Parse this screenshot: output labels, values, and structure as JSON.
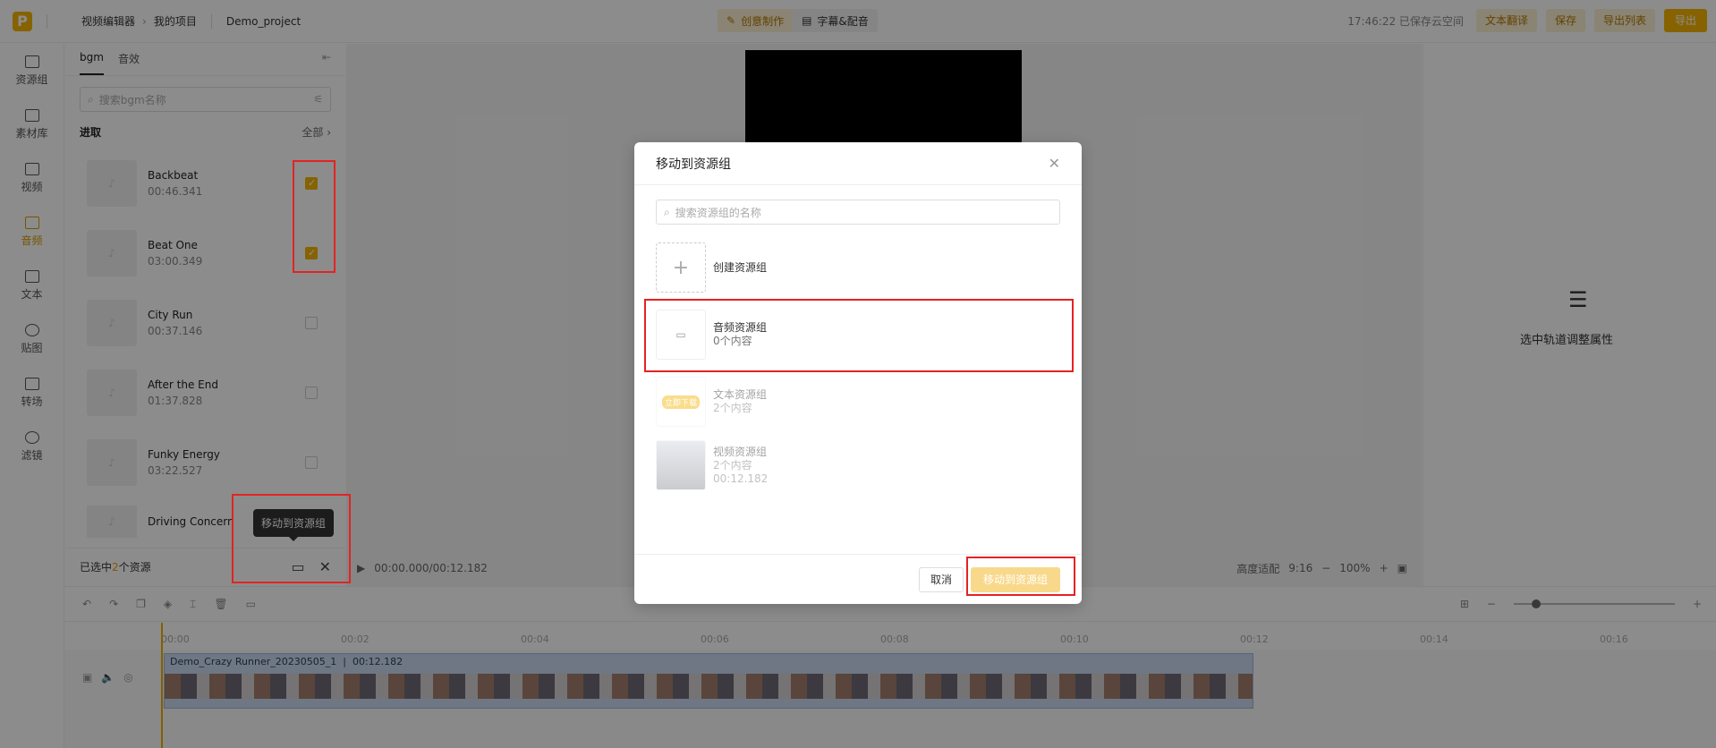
{
  "app": {
    "logo": "P",
    "breadcrumb": [
      "视频编辑器",
      "我的项目",
      "Demo_project"
    ]
  },
  "center_tabs": [
    {
      "label": "创意制作"
    },
    {
      "label": "字幕&配音"
    }
  ],
  "header_right": {
    "save_status": "17:46:22 已保存云空间",
    "translate": "文本翻译",
    "save": "保存",
    "export_list": "导出列表",
    "export": "导出"
  },
  "nav": [
    {
      "label": "资源组"
    },
    {
      "label": "素材库"
    },
    {
      "label": "视频"
    },
    {
      "label": "音频"
    },
    {
      "label": "文本"
    },
    {
      "label": "贴图"
    },
    {
      "label": "转场"
    },
    {
      "label": "滤镜"
    }
  ],
  "panel": {
    "tabs": [
      "bgm",
      "音效"
    ],
    "search_placeholder": "搜索bgm名称",
    "section_title": "进取",
    "section_all": "全部",
    "tracks": [
      {
        "name": "Backbeat",
        "duration": "00:46.341",
        "checked": true
      },
      {
        "name": "Beat One",
        "duration": "03:00.349",
        "checked": true
      },
      {
        "name": "City Run",
        "duration": "00:37.146",
        "checked": false
      },
      {
        "name": "After the End",
        "duration": "01:37.828",
        "checked": false
      },
      {
        "name": "Funky Energy",
        "duration": "03:22.527",
        "checked": false
      },
      {
        "name": "Driving Concern",
        "duration": "",
        "checked": false
      }
    ],
    "selection_prefix": "已选中",
    "selection_count": "2",
    "selection_suffix": "个资源",
    "tooltip": "移动到资源组"
  },
  "props": {
    "hint": "选中轨道调整属性"
  },
  "player": {
    "time": "00:00.000/00:12.182",
    "fit": "高度适配",
    "ratio": "9:16",
    "zoom": "100%"
  },
  "timeline": {
    "ticks": [
      "00:00",
      "00:02",
      "00:04",
      "00:06",
      "00:08",
      "00:10",
      "00:12",
      "00:14",
      "00:16"
    ],
    "clip_name": "Demo_Crazy Runner_20230505_1",
    "clip_duration": "00:12.182"
  },
  "modal": {
    "title": "移动到资源组",
    "search_placeholder": "搜索资源组的名称",
    "create_label": "创建资源组",
    "groups": [
      {
        "name": "音频资源组",
        "count": "0个内容",
        "extra": "",
        "badge": ""
      },
      {
        "name": "文本资源组",
        "count": "2个内容",
        "extra": "",
        "badge": "立即下载"
      },
      {
        "name": "视频资源组",
        "count": "2个内容",
        "extra": "00:12.182",
        "badge": ""
      }
    ],
    "cancel": "取消",
    "confirm": "移动到资源组"
  }
}
